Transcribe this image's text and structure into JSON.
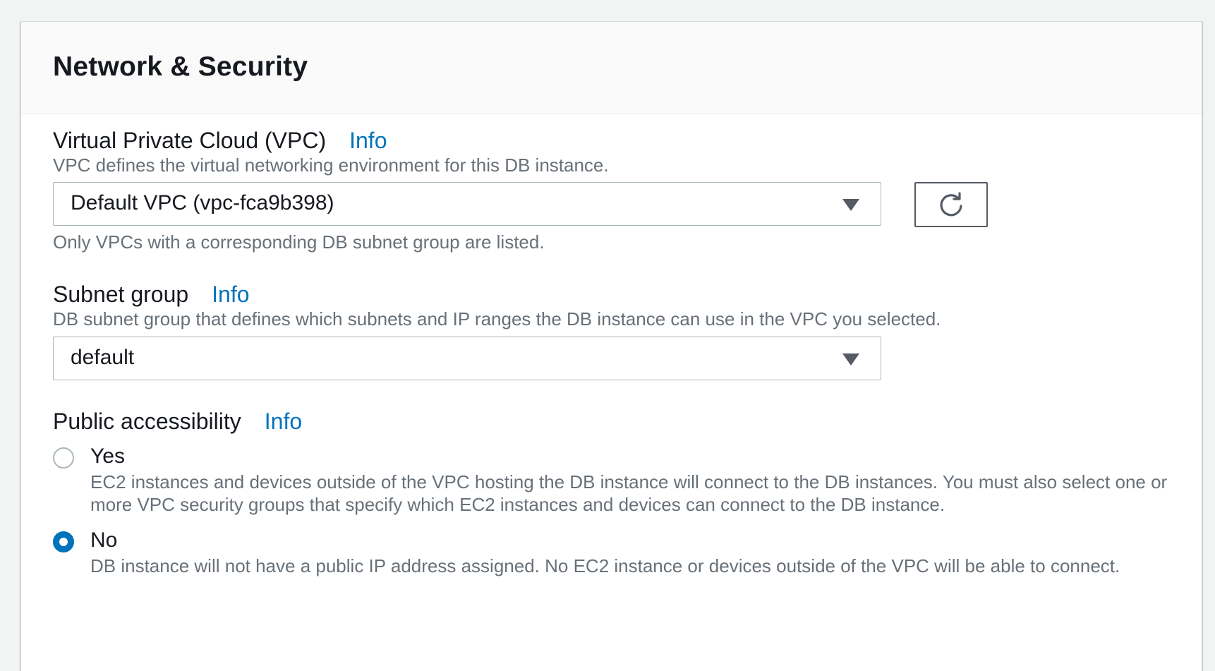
{
  "section": {
    "title": "Network & Security"
  },
  "vpc": {
    "label": "Virtual Private Cloud (VPC)",
    "info": "Info",
    "description": "VPC defines the virtual networking environment for this DB instance.",
    "selected": "Default VPC (vpc-fca9b398)",
    "hint": "Only VPCs with a corresponding DB subnet group are listed.",
    "refresh_icon": "refresh-icon"
  },
  "subnet": {
    "label": "Subnet group",
    "info": "Info",
    "description": "DB subnet group that defines which subnets and IP ranges the DB instance can use in the VPC you selected.",
    "selected": "default"
  },
  "public_access": {
    "label": "Public accessibility",
    "info": "Info",
    "options": [
      {
        "label": "Yes",
        "description": "EC2 instances and devices outside of the VPC hosting the DB instance will connect to the DB instances. You must also select one or more VPC security groups that specify which EC2 instances and devices can connect to the DB instance.",
        "selected": false
      },
      {
        "label": "No",
        "description": "DB instance will not have a public IP address assigned. No EC2 instance or devices outside of the VPC will be able to connect.",
        "selected": true
      }
    ]
  },
  "colors": {
    "link": "#0073bb",
    "radio_selected": "#0073bb",
    "secondary_text": "#687078"
  }
}
